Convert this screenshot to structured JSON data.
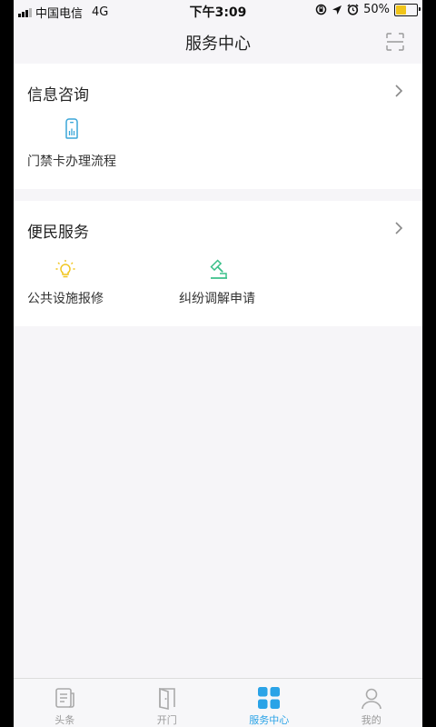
{
  "status_bar": {
    "carrier": "中国电信",
    "network": "4G",
    "time": "下午3:09",
    "battery_percent": "50%",
    "battery_level": 0.5
  },
  "header": {
    "title": "服务中心",
    "scan_icon": "scan-icon"
  },
  "sections": [
    {
      "title": "信息咨询",
      "items": [
        {
          "label": "门禁卡办理流程",
          "icon": "access-card-icon"
        }
      ]
    },
    {
      "title": "便民服务",
      "items": [
        {
          "label": "公共设施报修",
          "icon": "lightbulb-icon"
        },
        {
          "label": "纠纷调解申请",
          "icon": "gavel-icon"
        }
      ]
    }
  ],
  "tabs": [
    {
      "label": "头条",
      "icon": "news-icon",
      "active": false
    },
    {
      "label": "开门",
      "icon": "door-icon",
      "active": false
    },
    {
      "label": "服务中心",
      "icon": "grid-icon",
      "active": true
    },
    {
      "label": "我的",
      "icon": "user-icon",
      "active": false
    }
  ],
  "colors": {
    "accent": "#2aa3e7",
    "gavel_green": "#3cc08a",
    "bulb_yellow": "#f0c419",
    "background": "#f6f5f8"
  }
}
